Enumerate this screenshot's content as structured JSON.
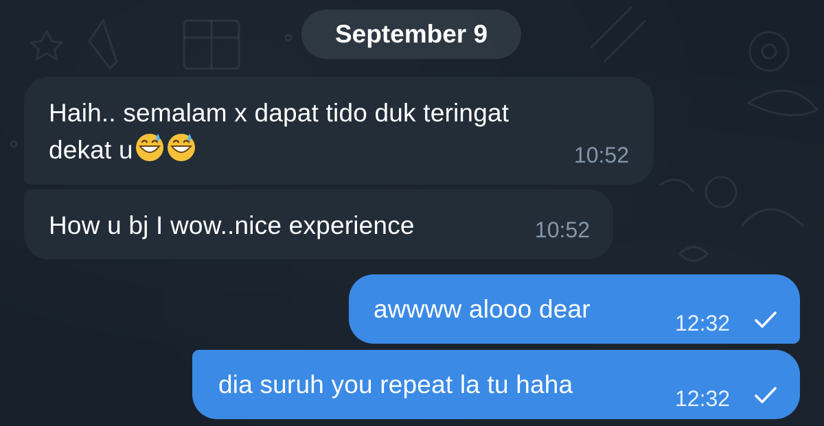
{
  "chat": {
    "date_label": "September 9",
    "messages": [
      {
        "direction": "incoming",
        "text_line1": "Haih.. semalam x dapat tido duk teringat",
        "text_line2": "dekat u",
        "emoji": [
          "grinning-face-with-sweat",
          "grinning-face-with-sweat"
        ],
        "time": "10:52"
      },
      {
        "direction": "incoming",
        "text": "How u bj I wow..nice experience",
        "time": "10:52"
      },
      {
        "direction": "outgoing",
        "text": "awwww alooo dear",
        "time": "12:32",
        "status_icon": "single-check-icon"
      },
      {
        "direction": "outgoing",
        "text": "dia suruh you repeat la tu haha",
        "time": "12:32",
        "status_icon": "single-check-icon"
      }
    ]
  },
  "colors": {
    "background": "#18212b",
    "incoming_bubble": "#222d38",
    "outgoing_bubble": "#3b8ae6",
    "date_pill": "#3c4854",
    "incoming_time": "#8496a8",
    "outgoing_time": "#e6f0ff"
  }
}
